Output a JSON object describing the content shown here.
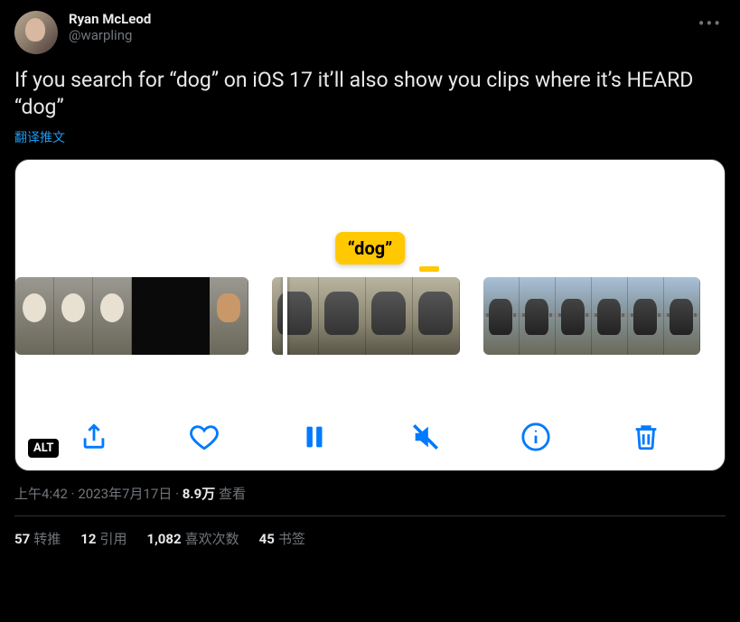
{
  "author": {
    "name": "Ryan McLeod",
    "handle": "@warpling"
  },
  "tweet_text": "If you search for “dog” on iOS 17 it’ll also show you clips where it’s HEARD “dog”",
  "translate_label": "翻译推文",
  "media": {
    "search_term": "“dog”",
    "alt_badge": "ALT"
  },
  "meta": {
    "time": "上午4:42",
    "date": "2023年7月17日",
    "views_count": "8.9万",
    "views_label": "查看"
  },
  "stats": {
    "retweets_count": "57",
    "retweets_label": "转推",
    "quotes_count": "12",
    "quotes_label": "引用",
    "likes_count": "1,082",
    "likes_label": "喜欢次数",
    "bookmarks_count": "45",
    "bookmarks_label": "书签"
  }
}
